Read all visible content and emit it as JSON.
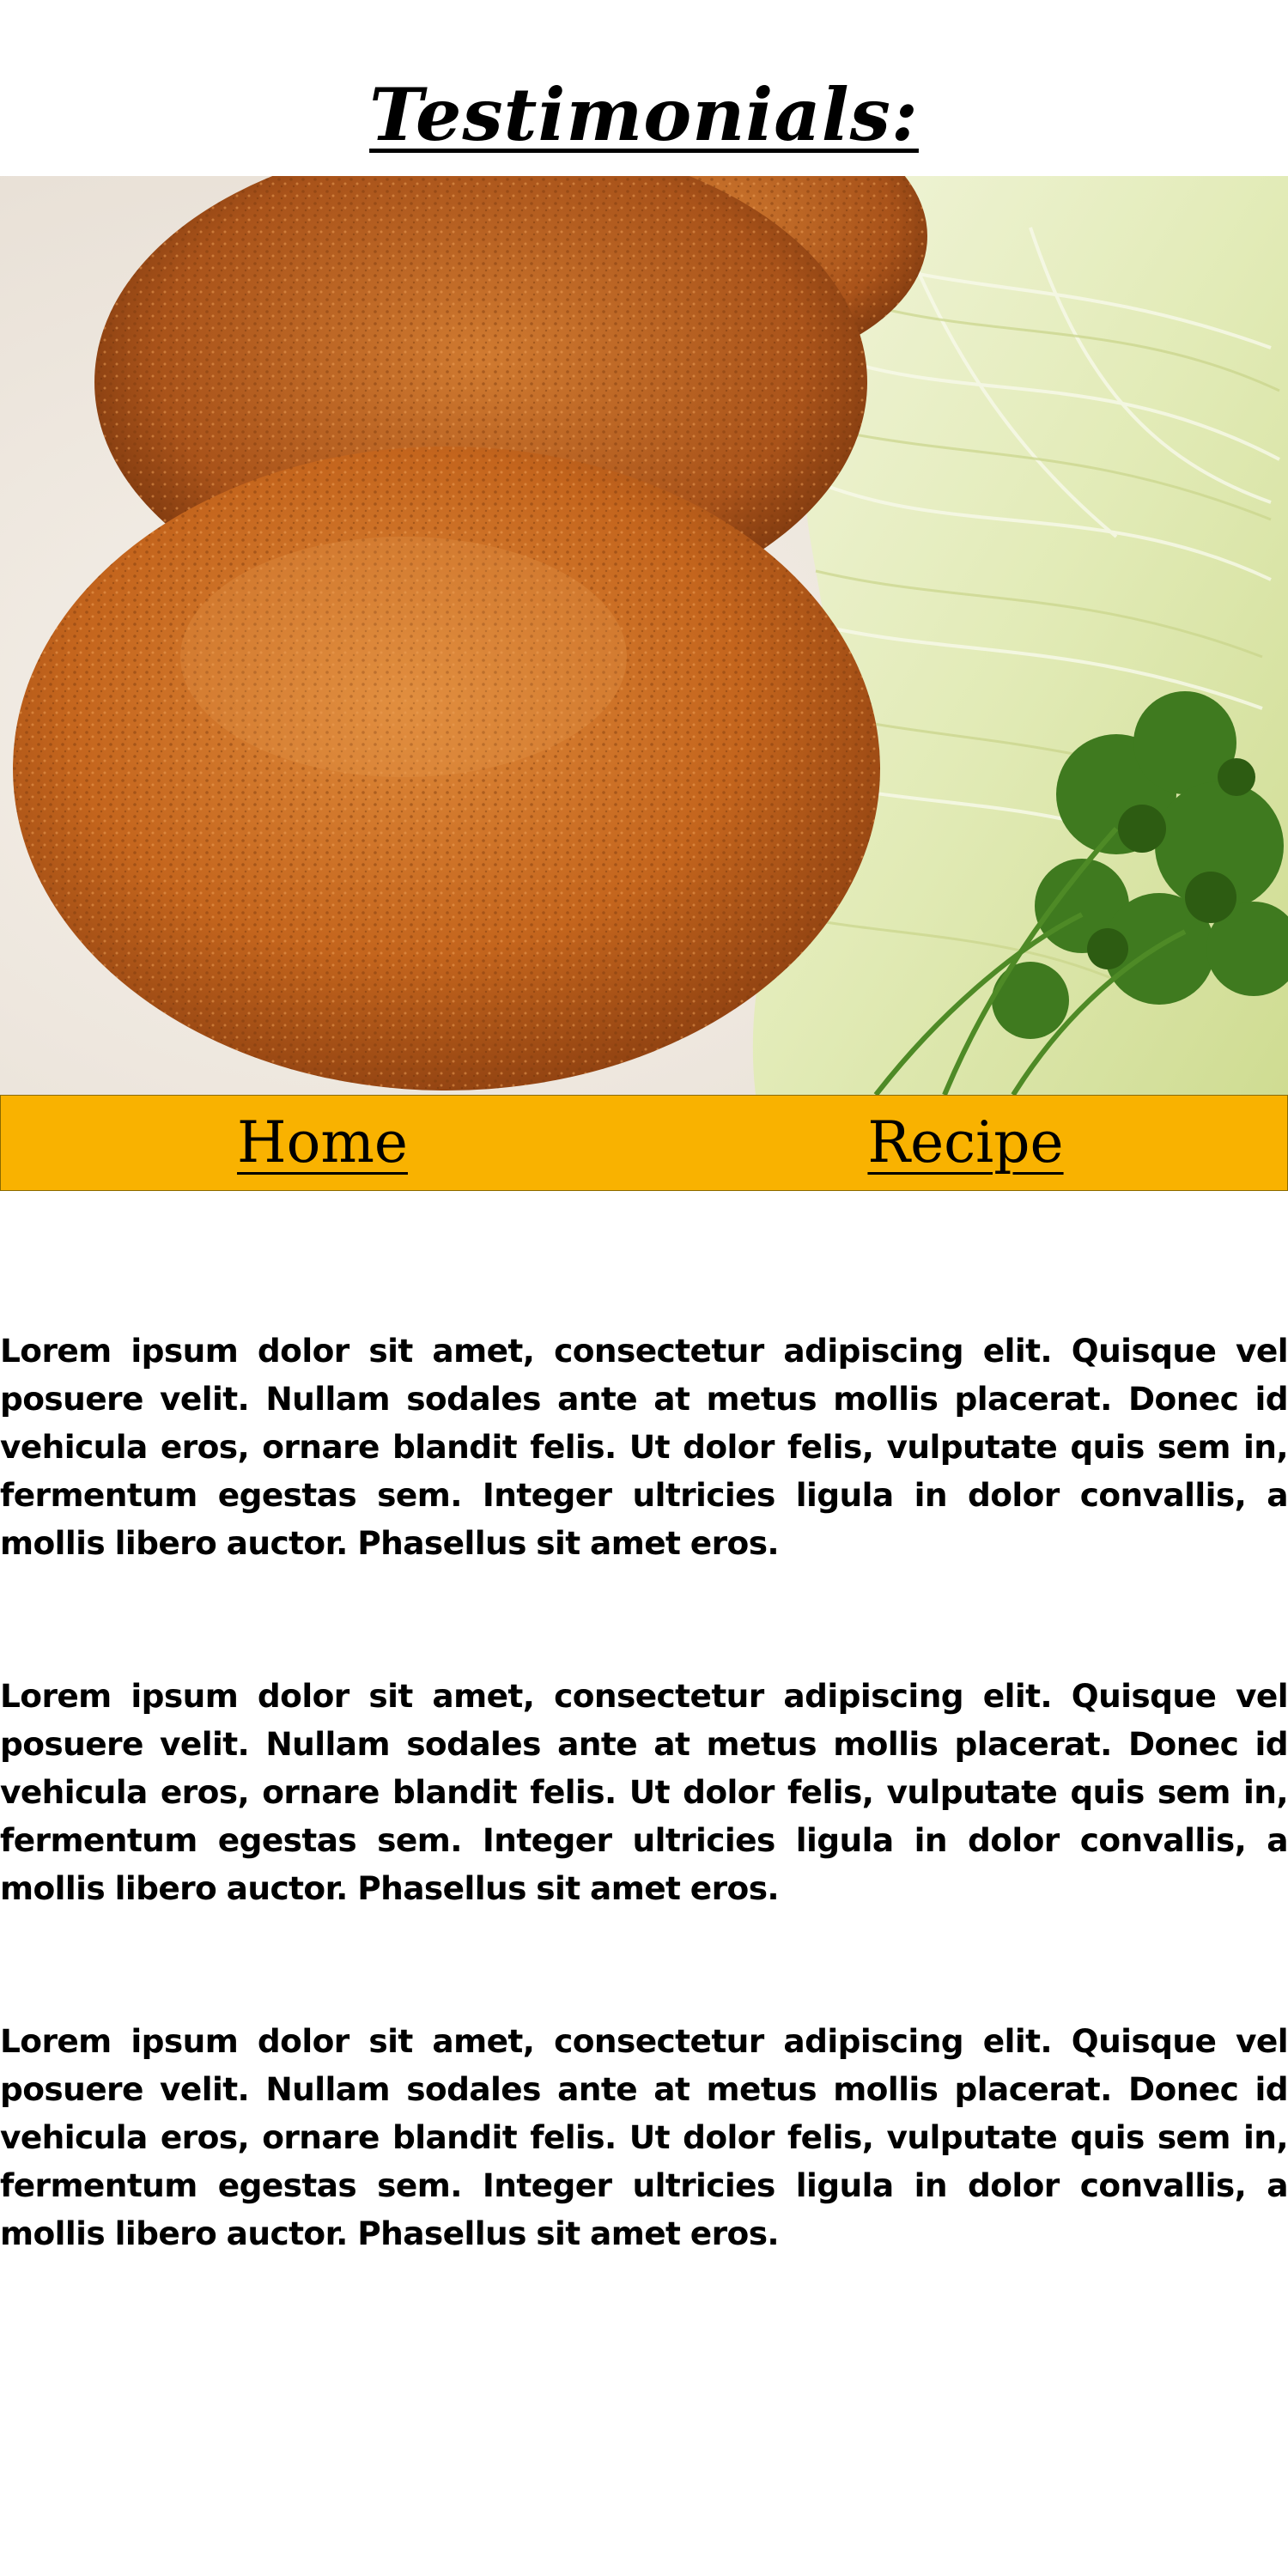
{
  "page": {
    "title": "Testimonials:"
  },
  "hero": {
    "image_subject": "fried croquettes with shredded cabbage and parsley",
    "colors": {
      "croquette": "#c8661e",
      "cabbage": "#e9efc8",
      "parsley": "#3f7a1f",
      "plate": "#f2ece4"
    }
  },
  "nav": {
    "background": "#f9b200",
    "items": [
      {
        "label": "Home"
      },
      {
        "label": "Recipe"
      }
    ]
  },
  "testimonials": [
    {
      "text": "Lorem ipsum dolor sit amet, consectetur adipiscing elit. Quisque vel posuere velit. Nullam sodales ante at metus mollis placerat. Donec id vehicula eros, ornare blandit felis. Ut dolor felis, vulputate quis sem in, fermentum egestas sem. Integer ultricies ligula in dolor convallis, a mollis libero auctor. Phasellus sit amet eros."
    },
    {
      "text": "Lorem ipsum dolor sit amet, consectetur adipiscing elit. Quisque vel posuere velit. Nullam sodales ante at metus mollis placerat. Donec id vehicula eros, ornare blandit felis. Ut dolor felis, vulputate quis sem in, fermentum egestas sem. Integer ultricies ligula in dolor convallis, a mollis libero auctor. Phasellus sit amet eros."
    },
    {
      "text": "Lorem ipsum dolor sit amet, consectetur adipiscing elit. Quisque vel posuere velit. Nullam sodales ante at metus mollis placerat. Donec id vehicula eros, ornare blandit felis. Ut dolor felis, vulputate quis sem in, fermentum egestas sem. Integer ultricies ligula in dolor convallis, a mollis libero auctor. Phasellus sit amet eros."
    }
  ]
}
